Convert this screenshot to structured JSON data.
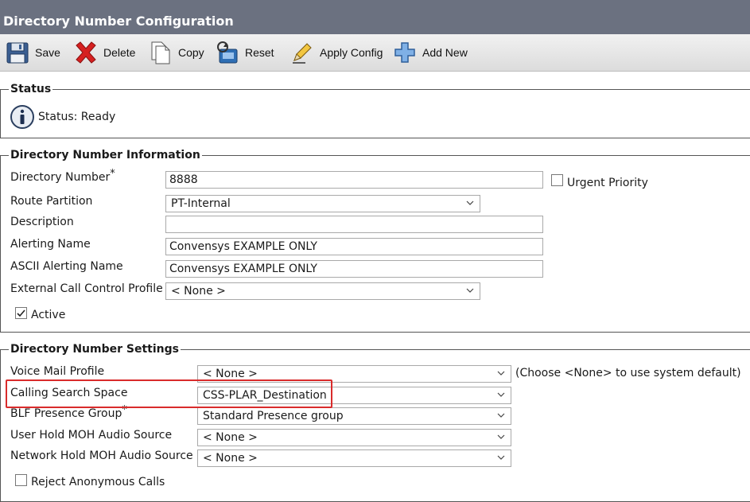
{
  "page": {
    "title": "Directory Number Configuration"
  },
  "toolbar": {
    "save_label": "Save",
    "delete_label": "Delete",
    "copy_label": "Copy",
    "reset_label": "Reset",
    "apply_config_label": "Apply Config",
    "add_new_label": "Add New"
  },
  "status": {
    "legend": "Status",
    "text": "Status: Ready"
  },
  "dn_info": {
    "legend": "Directory Number Information",
    "directory_number_label": "Directory Number",
    "directory_number_value": "8888",
    "required_mark": "*",
    "urgent_priority_label": "Urgent Priority",
    "route_partition_label": "Route Partition",
    "route_partition_value": "PT-Internal",
    "description_label": "Description",
    "description_value": "",
    "alerting_name_label": "Alerting Name",
    "alerting_name_value": "Convensys EXAMPLE ONLY",
    "ascii_alerting_name_label": "ASCII Alerting Name",
    "ascii_alerting_name_value": "Convensys EXAMPLE ONLY",
    "ext_call_control_label": "External Call Control Profile",
    "ext_call_control_value": "< None >",
    "active_label": "Active",
    "active_checked": true,
    "urgent_checked": false
  },
  "dn_settings": {
    "legend": "Directory Number Settings",
    "voice_mail_label": "Voice Mail Profile",
    "voice_mail_value": "< None >",
    "voice_mail_hint": "(Choose <None> to use system default)",
    "css_label": "Calling Search Space",
    "css_value": "CSS-PLAR_Destination",
    "blf_label": "BLF Presence Group",
    "blf_value": "Standard Presence group",
    "user_hold_label": "User Hold MOH Audio Source",
    "user_hold_value": "< None >",
    "network_hold_label": "Network Hold MOH Audio Source",
    "network_hold_value": "< None >",
    "reject_anon_label": "Reject Anonymous Calls",
    "reject_anon_checked": false
  },
  "colors": {
    "titlebar": "#6b7180",
    "highlight": "#d92b2b",
    "delete_icon": "#d62020",
    "add_icon": "#4a7fc9"
  }
}
